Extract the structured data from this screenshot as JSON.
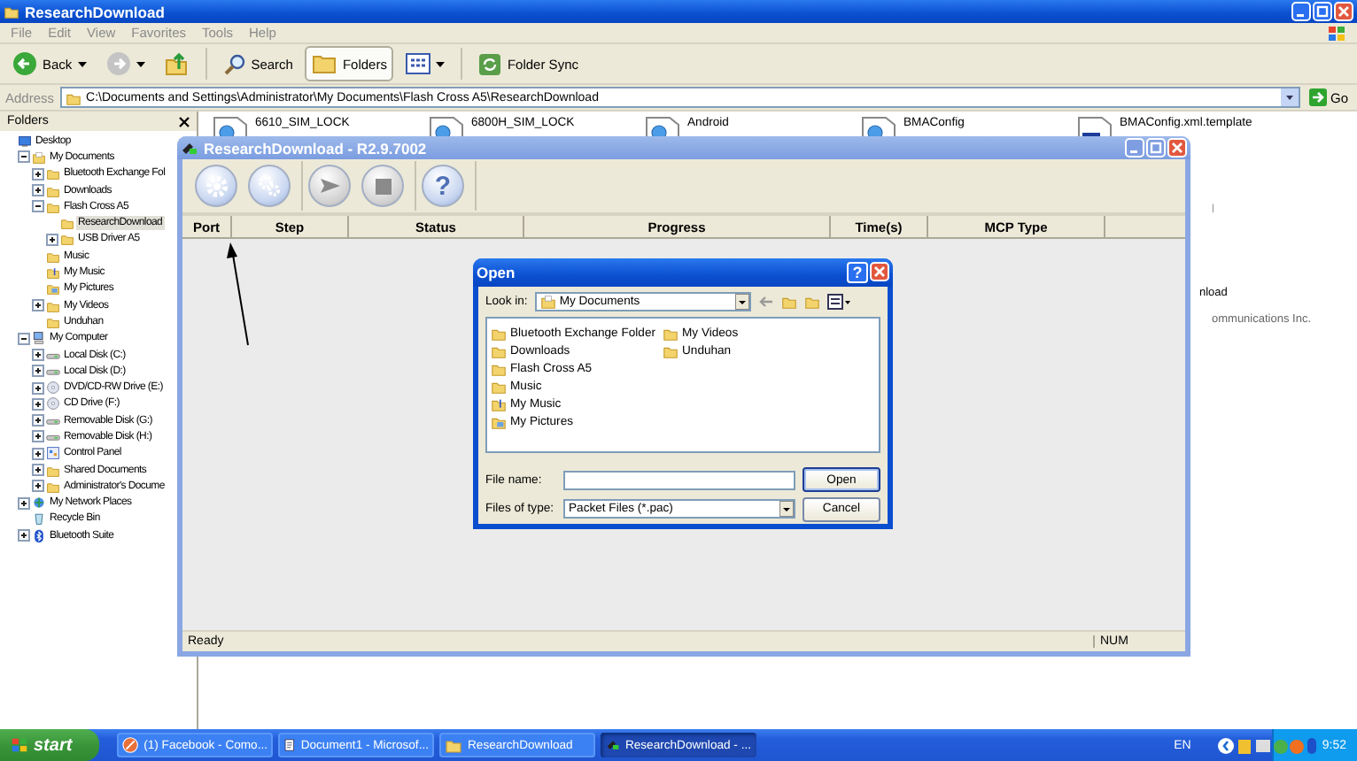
{
  "explorer": {
    "title": "ResearchDownload",
    "menu": [
      "File",
      "Edit",
      "View",
      "Favorites",
      "Tools",
      "Help"
    ],
    "toolbar": [
      {
        "kind": "back",
        "label": "Back",
        "pressed": false
      },
      {
        "kind": "forward",
        "pressed": false
      },
      {
        "kind": "up",
        "pressed": false
      },
      {
        "kind": "separator"
      },
      {
        "kind": "search",
        "label": "Search",
        "pressed": false
      },
      {
        "kind": "folders",
        "label": "Folders",
        "pressed": true
      },
      {
        "kind": "views",
        "pressed": false
      },
      {
        "kind": "separator"
      },
      {
        "kind": "sync",
        "label": "Folder Sync",
        "pressed": false
      }
    ],
    "address": {
      "label": "Address",
      "value": "C:\\Documents and Settings\\Administrator\\My Documents\\Flash Cross A5\\ResearchDownload",
      "go": "Go"
    },
    "folders_pane": {
      "title": "Folders",
      "tree": [
        {
          "label": "Desktop",
          "kind": "desktop",
          "selected": false,
          "children": [
            {
              "label": "My Documents",
              "kind": "documents",
              "expanded": true,
              "selected": false,
              "children": [
                {
                  "label": "Bluetooth Exchange Fol",
                  "kind": "folder",
                  "expanded": false,
                  "selected": false
                },
                {
                  "label": "Downloads",
                  "kind": "folder",
                  "expanded": false,
                  "selected": false
                },
                {
                  "label": "Flash Cross A5",
                  "kind": "folder",
                  "expanded": true,
                  "selected": false,
                  "children": [
                    {
                      "label": "ResearchDownload",
                      "kind": "folder",
                      "selected": true
                    },
                    {
                      "label": "USB Driver A5",
                      "kind": "folder",
                      "expanded": false,
                      "selected": false
                    }
                  ]
                },
                {
                  "label": "Music",
                  "kind": "folder",
                  "selected": false
                },
                {
                  "label": "My Music",
                  "kind": "music",
                  "selected": false
                },
                {
                  "label": "My Pictures",
                  "kind": "pictures",
                  "selected": false
                },
                {
                  "label": "My Videos",
                  "kind": "folder",
                  "expanded": false,
                  "selected": false
                },
                {
                  "label": "Unduhan",
                  "kind": "folder",
                  "selected": false
                }
              ]
            },
            {
              "label": "My Computer",
              "kind": "computer",
              "expanded": true,
              "selected": false,
              "children": [
                {
                  "label": "Local Disk (C:)",
                  "kind": "disk",
                  "expanded": false,
                  "selected": false
                },
                {
                  "label": "Local Disk (D:)",
                  "kind": "disk",
                  "expanded": false,
                  "selected": false
                },
                {
                  "label": "DVD/CD-RW Drive (E:)",
                  "kind": "cd",
                  "expanded": false,
                  "selected": false
                },
                {
                  "label": "CD Drive (F:)",
                  "kind": "cd",
                  "expanded": false,
                  "selected": false
                },
                {
                  "label": "Removable Disk (G:)",
                  "kind": "disk",
                  "expanded": false,
                  "selected": false
                },
                {
                  "label": "Removable Disk (H:)",
                  "kind": "disk",
                  "expanded": false,
                  "selected": false
                },
                {
                  "label": "Control Panel",
                  "kind": "panel",
                  "expanded": false,
                  "selected": false
                },
                {
                  "label": "Shared Documents",
                  "kind": "folder",
                  "expanded": false,
                  "selected": false
                },
                {
                  "label": "Administrator's Docume",
                  "kind": "folder",
                  "expanded": false,
                  "selected": false
                }
              ]
            },
            {
              "label": "My Network Places",
              "kind": "network",
              "expanded": false,
              "selected": false
            },
            {
              "label": "Recycle Bin",
              "kind": "recycle",
              "selected": false
            },
            {
              "label": "Bluetooth Suite",
              "kind": "bluetooth",
              "expanded": false,
              "selected": false
            }
          ]
        }
      ]
    },
    "files": [
      {
        "name": "6610_SIM_LOCK",
        "kind": "web"
      },
      {
        "name": "6800H_SIM_LOCK",
        "kind": "web"
      },
      {
        "name": "Android",
        "kind": "web"
      },
      {
        "name": "BMAConfig",
        "kind": "web"
      },
      {
        "name": "BMAConfig.xml.template",
        "kind": "document"
      }
    ],
    "covered_texts": [
      "l",
      "nload",
      "ommunications Inc."
    ]
  },
  "research_download": {
    "title": "ResearchDownload - R2.9.7002",
    "tool_groups": [
      [
        {
          "kind": "settings"
        },
        {
          "kind": "settings-multi"
        }
      ],
      [
        {
          "kind": "start"
        },
        {
          "kind": "stop"
        }
      ],
      [
        {
          "kind": "help",
          "label": "?"
        }
      ]
    ],
    "columns": [
      "Port",
      "Step",
      "Status",
      "Progress",
      "Time(s)",
      "MCP Type"
    ],
    "status": "Ready",
    "indicator": "NUM"
  },
  "open_dialog": {
    "title": "Open",
    "help": "?",
    "look_in_label": "Look in:",
    "look_in_value": "My Documents",
    "items": [
      {
        "label": "Bluetooth Exchange Folder",
        "kind": "folder"
      },
      {
        "label": "Downloads",
        "kind": "folder"
      },
      {
        "label": "Flash Cross A5",
        "kind": "folder"
      },
      {
        "label": "Music",
        "kind": "folder"
      },
      {
        "label": "My Music",
        "kind": "music"
      },
      {
        "label": "My Pictures",
        "kind": "pictures"
      },
      {
        "label": "My Videos",
        "kind": "folder"
      },
      {
        "label": "Unduhan",
        "kind": "folder"
      }
    ],
    "file_name_label": "File name:",
    "type_label": "Files of type:",
    "type_value": "Packet Files (*.pac)",
    "open": "Open",
    "cancel": "Cancel"
  },
  "taskbar": {
    "start": "start",
    "tasks": [
      {
        "label": "(1) Facebook - Como...",
        "kind": "browser",
        "selected": false
      },
      {
        "label": "Document1 - Microsof...",
        "kind": "document",
        "selected": false
      },
      {
        "label": "ResearchDownload",
        "kind": "folder",
        "selected": false
      },
      {
        "label": "ResearchDownload - ...",
        "kind": "app",
        "selected": true
      }
    ],
    "language": "EN",
    "clock": "9:52"
  }
}
